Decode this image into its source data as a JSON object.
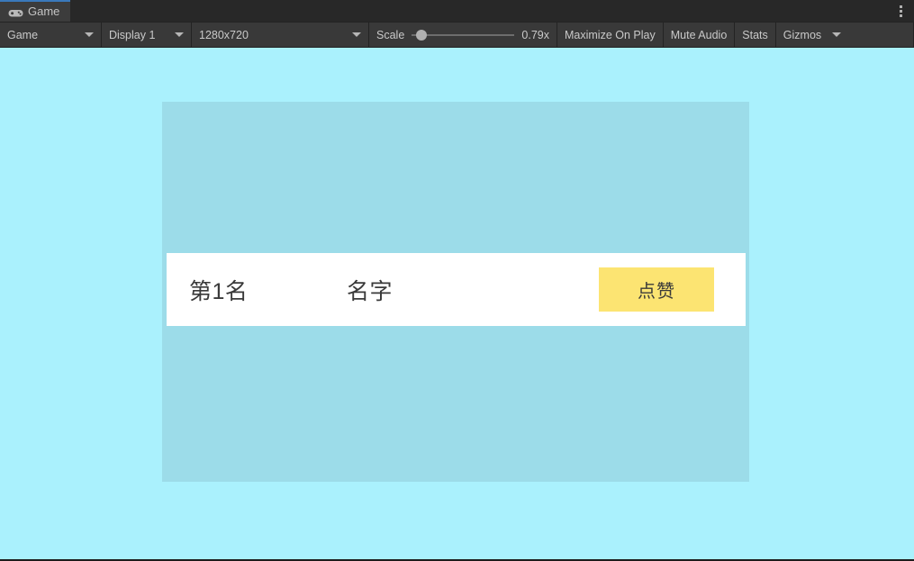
{
  "window": {
    "tabs": [
      {
        "label": "Game",
        "icon": "gamepad-icon",
        "active": true
      }
    ],
    "overflow_menu_icon": "kebab-menu-icon"
  },
  "toolbar": {
    "view_selector": {
      "label": "Game",
      "icon": "chevron-down-icon"
    },
    "display_selector": {
      "label": "Display 1",
      "icon": "chevron-down-icon"
    },
    "resolution_selector": {
      "label": "1280x720",
      "icon": "chevron-down-icon"
    },
    "scale": {
      "label": "Scale",
      "value": "0.79x",
      "handle_percent": 4
    },
    "maximize_on_play": "Maximize On Play",
    "mute_audio": "Mute Audio",
    "stats": "Stats",
    "gizmos": {
      "label": "Gizmos",
      "icon": "chevron-down-icon"
    }
  },
  "game": {
    "background_color": "#aaf1fd",
    "panel_color": "#9cdce9",
    "row": {
      "background_color": "#ffffff",
      "rank": "第1名",
      "name": "名字",
      "like_button": {
        "label": "点赞",
        "color": "#fce472"
      }
    }
  }
}
